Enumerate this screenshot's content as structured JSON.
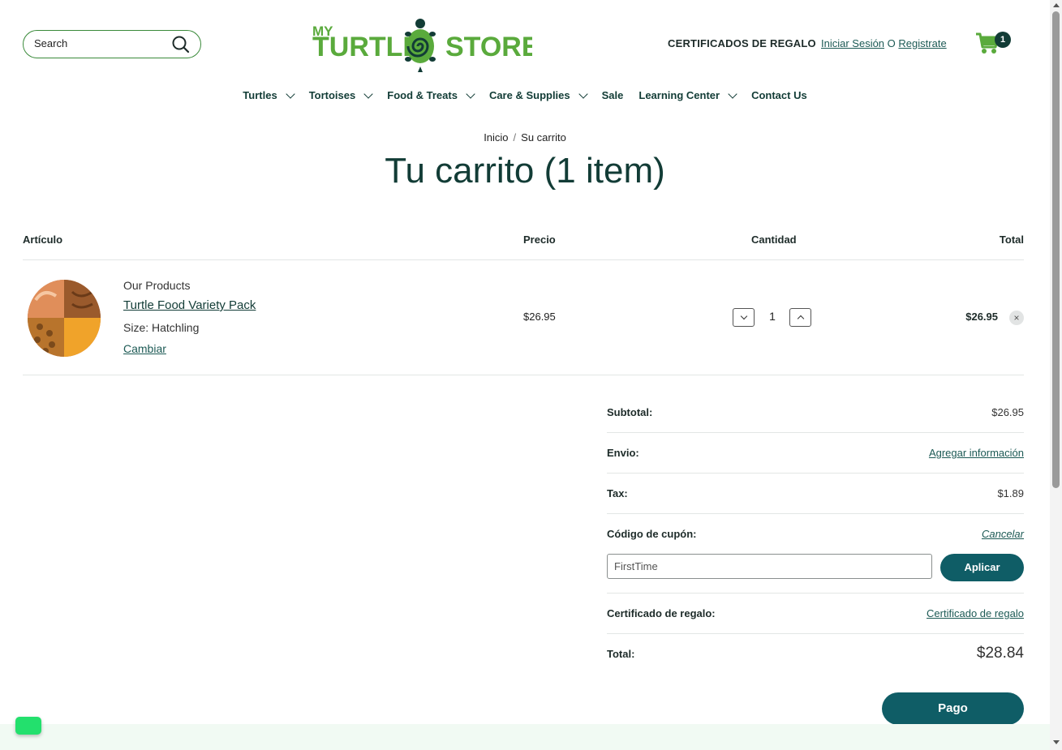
{
  "header": {
    "search_placeholder": "Search",
    "logo_text_my": "MY",
    "logo_text_turtle": "TURTLE",
    "logo_text_store": "STORE",
    "gift_certificates": "CERTIFICADOS DE REGALO",
    "login": "Iniciar Sesión",
    "or": "O",
    "register": "Registrate",
    "cart_count": "1",
    "icons": [
      "search-icon",
      "cart-icon",
      "logo-turtle-icon"
    ]
  },
  "nav": {
    "items": [
      {
        "label": "Turtles",
        "dropdown": true
      },
      {
        "label": "Tortoises",
        "dropdown": true
      },
      {
        "label": "Food & Treats",
        "dropdown": true
      },
      {
        "label": "Care & Supplies",
        "dropdown": true
      },
      {
        "label": "Sale",
        "dropdown": false
      },
      {
        "label": "Learning Center",
        "dropdown": true
      },
      {
        "label": "Contact Us",
        "dropdown": false
      }
    ]
  },
  "breadcrumb": {
    "home": "Inicio",
    "sep": "/",
    "current": "Su carrito"
  },
  "page_title": "Tu carrito (1 item)",
  "table": {
    "headers": {
      "item": "Artículo",
      "price": "Precio",
      "quantity": "Cantidad",
      "total": "Total"
    },
    "row": {
      "vendor": "Our Products",
      "name": "Turtle Food Variety Pack",
      "variant": "Size: Hatchling",
      "change": "Cambiar",
      "price": "$26.95",
      "quantity": "1",
      "total": "$26.95",
      "remove": "×"
    }
  },
  "summary": {
    "subtotal_label": "Subtotal:",
    "subtotal_value": "$26.95",
    "shipping_label": "Envio:",
    "shipping_link": "Agregar información",
    "tax_label": "Tax:",
    "tax_value": "$1.89",
    "coupon_label": "Código de cupón:",
    "coupon_cancel": "Cancelar",
    "coupon_value": "FirstTime",
    "apply": "Aplicar",
    "gift_label": "Certificado de regalo:",
    "gift_link": "Certificado de regalo",
    "total_label": "Total:",
    "total_value": "$28.84",
    "checkout": "Pago"
  },
  "colors": {
    "brand_green": "#5aaa3c",
    "dark_teal": "#123c36",
    "button_teal": "#0f5d66",
    "chat_green": "#23e06d"
  }
}
